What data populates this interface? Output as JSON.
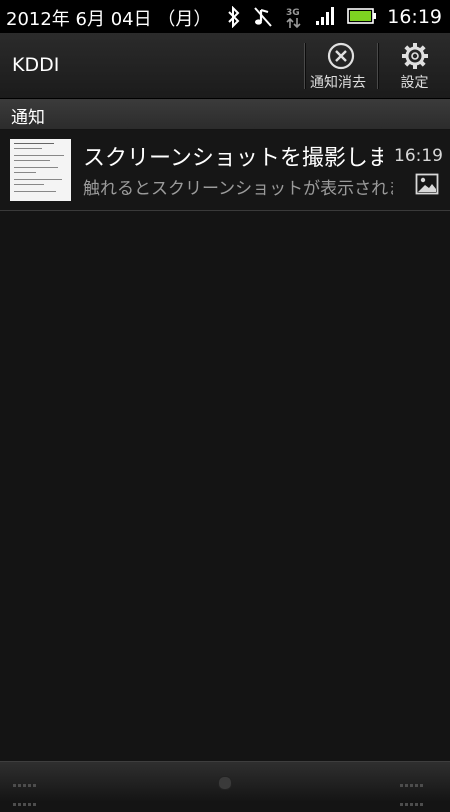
{
  "status": {
    "date": "2012年 6月 04日 （月）",
    "time": "16:19",
    "network": "3G",
    "icons": [
      "bluetooth-icon",
      "vibrate-off-icon",
      "3g-data-icon",
      "signal-icon",
      "battery-icon"
    ]
  },
  "header": {
    "carrier": "KDDI",
    "clear_label": "通知消去",
    "settings_label": "設定"
  },
  "section": {
    "title": "通知"
  },
  "notifications": [
    {
      "title": "スクリーンショットを撮影しました",
      "subtitle": "触れるとスクリーンショットが表示されます",
      "time": "16:19",
      "icon": "image-icon"
    }
  ],
  "colors": {
    "background": "#141414",
    "battery_green": "#7ed321",
    "subtext": "#9b9b9b"
  }
}
